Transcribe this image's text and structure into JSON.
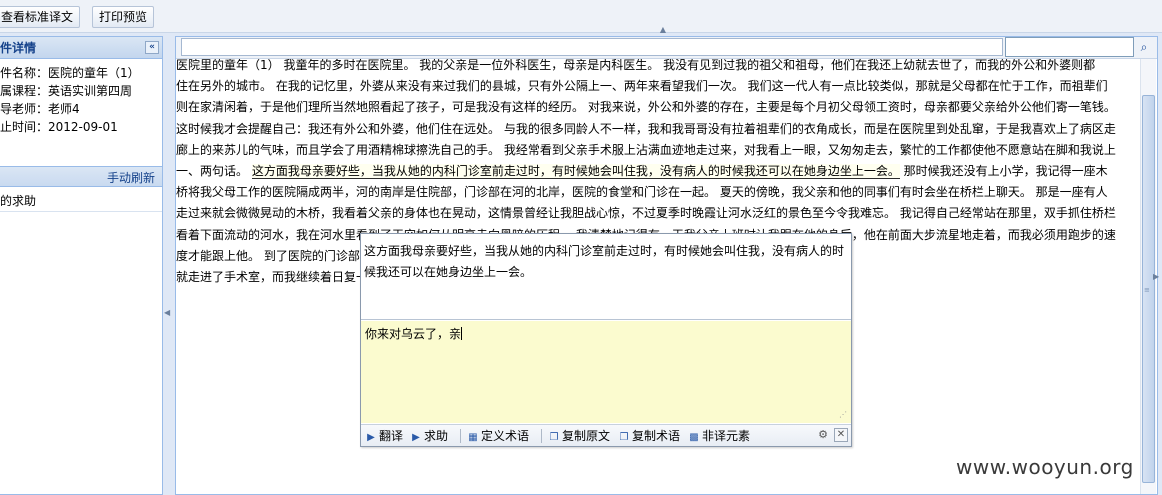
{
  "toolbar": {
    "view_standard_label": "查看标准译文",
    "print_preview_label": "打印预览"
  },
  "sidebar": {
    "title": "件详情",
    "info": [
      {
        "label": "件名称：",
        "value": "医院的童年（1）"
      },
      {
        "label": "属课程：",
        "value": "英语实训第四周"
      },
      {
        "label": "导老师：",
        "value": "老师4"
      },
      {
        "label": "止时间：",
        "value": "2012-09-01"
      }
    ],
    "refresh_label": "手动刷新",
    "help_item": "的求助"
  },
  "document": {
    "lines": [
      "医院里的童年（1）   我童年的多时在医院里。   我的父亲是一位外科医生，母亲是内科医生。   我没有见到过我的祖父和祖母，他们在我还上幼就去世了，而我的外公和外婆则都",
      "住在另外的城市。    在我的记忆里，外婆从来没有来过我们的县城，只有外公隔上一、两年来看望我们一次。    我们这一代人有一点比较类似，那就是父母都在忙于工作，而祖辈们",
      "则在家清闲着，于是他们理所当然地照看起了孩子，可是我没有这样的经历。    对我来说，外公和外婆的存在，主要是每个月初父母领工资时，母亲都要父亲给外公他们寄一笔钱。",
      " 这时候我才会提醒自己：我还有外公和外婆，他们住在远处。    与我的很多同龄人不一样，我和我哥哥没有拉着祖辈们的衣角成长，而是在医院里到处乱窜，于是我喜欢上了病区走",
      "廊上的来苏儿的气味，而且学会了用酒精棉球擦洗自己的手。    我经常看到父亲手术服上沾满血迹地走过来，对我看上一眼，又匆匆走去，繁忙的工作都使他不愿意站在脚和我说上",
      "一、两句话。   ",
      "桥将我父母工作的医院隔成两半，河的南岸是住院部，门诊部在河的北岸，医院的食堂和门诊在一起。    夏天的傍晚，我父亲和他的同事们有时会坐在桥栏上聊天。    那是一座有人",
      "走过来就会微微晃动的木桥，我看着父亲的身体也在晃动，这情景曾经让我胆战心惊，不过夏季时晚霞让河水泛红的景色至今令我难忘。    我记得自己经常站在那里，双手抓住桥栏",
      "看着下面流动的河水，我在河水里看到了天空如何从明亮走向黑暗的历程。    我清楚地记得有一天我父亲上班时让我跟在他的身后，他在前面大步流星地走着，而我必须用跑步的速",
      "度才能跟上他。    到了医院的门诊部，他带着我在里面绕着走了一圈，又从木桥上回到了门诊部，将车送还以后，他",
      "就走进了手术室，而我继续着日复一日"
    ],
    "highlight": "这方面我母亲要好些，当我从她的内科门诊室前走过时，有时候她会叫住我，没有病人的时候我还可以在她身边坐上一会。",
    "after_highlight": "    那时候我还没有上小学，我记得一座木",
    "under_highlight_line9": "看到了天空如何从明亮走向黑暗的历程。"
  },
  "popup": {
    "source_text": "这方面我母亲要好些，当我从她的内科门诊室前走过时，有时候她会叫住我，没有病人的时候我还可以在她身边坐上一会。",
    "translation_text": "你来对乌云了，亲",
    "buttons": {
      "translate": "翻译",
      "help": "求助",
      "define_term": "定义术语",
      "copy_source": "复制原文",
      "copy_term": "复制术语",
      "non_translate": "非译元素"
    }
  },
  "watermark": "www.wooyun.org"
}
